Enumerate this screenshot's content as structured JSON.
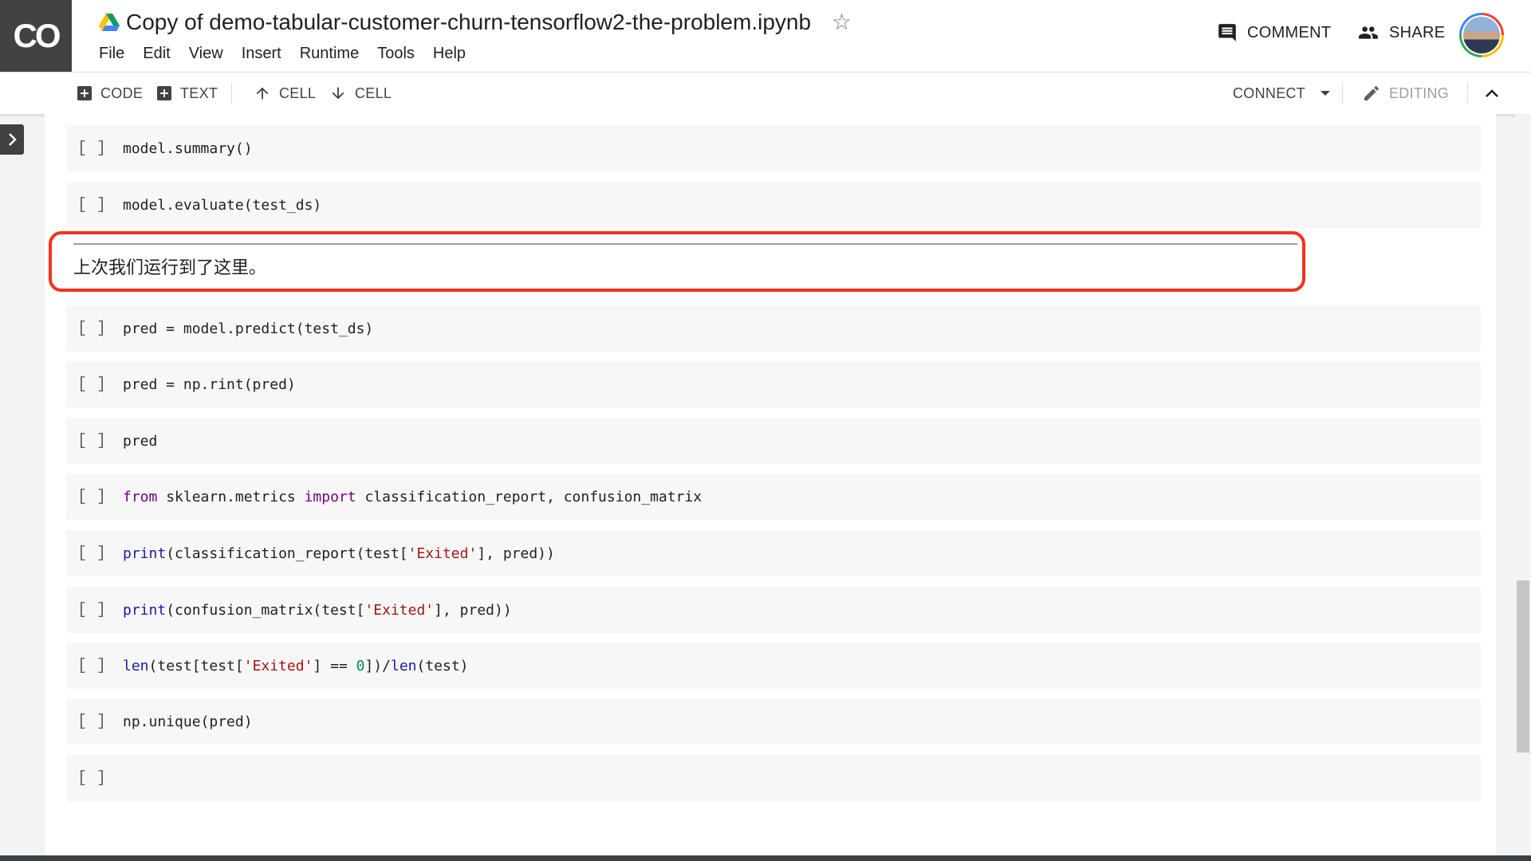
{
  "app": {
    "logo_text": "CO",
    "doc_title": "Copy of demo-tabular-customer-churn-tensorflow2-the-problem.ipynb"
  },
  "menu": [
    "File",
    "Edit",
    "View",
    "Insert",
    "Runtime",
    "Tools",
    "Help"
  ],
  "header_actions": {
    "comment": "COMMENT",
    "share": "SHARE"
  },
  "toolbar": {
    "add_code": "CODE",
    "add_text": "TEXT",
    "cell_up": "CELL",
    "cell_down": "CELL",
    "connect": "CONNECT",
    "editing": "EDITING"
  },
  "cells": [
    {
      "bracket": "[ ]",
      "code": "model.summary()"
    },
    {
      "bracket": "[ ]",
      "code": "model.evaluate(test_ds)"
    },
    {
      "bracket": "[ ]",
      "code": "pred = model.predict(test_ds)"
    },
    {
      "bracket": "[ ]",
      "code": "pred = np.rint(pred)"
    },
    {
      "bracket": "[ ]",
      "code": "pred"
    },
    {
      "bracket": "[ ]",
      "code_parts": [
        "from",
        " sklearn.metrics ",
        "import",
        " classification_report, confusion_matrix"
      ]
    },
    {
      "bracket": "[ ]",
      "code_parts": [
        "print",
        "(classification_report(test[",
        "'Exited'",
        "], pred))"
      ]
    },
    {
      "bracket": "[ ]",
      "code_parts": [
        "print",
        "(confusion_matrix(test[",
        "'Exited'",
        "], pred))"
      ]
    },
    {
      "bracket": "[ ]",
      "code_parts": [
        "len",
        "(test[test[",
        "'Exited'",
        "] == ",
        "0",
        "])/",
        "len",
        "(test)"
      ]
    },
    {
      "bracket": "[ ]",
      "code": "np.unique(pred)"
    },
    {
      "bracket": "[ ]",
      "code": ""
    }
  ],
  "text_cell": {
    "text": "上次我们运行到了这里。"
  },
  "colors": {
    "highlight_box": "#f4311f",
    "keyword": "#770088",
    "string": "#a31515",
    "number": "#09885a",
    "builtin": "#1a1aa6"
  }
}
